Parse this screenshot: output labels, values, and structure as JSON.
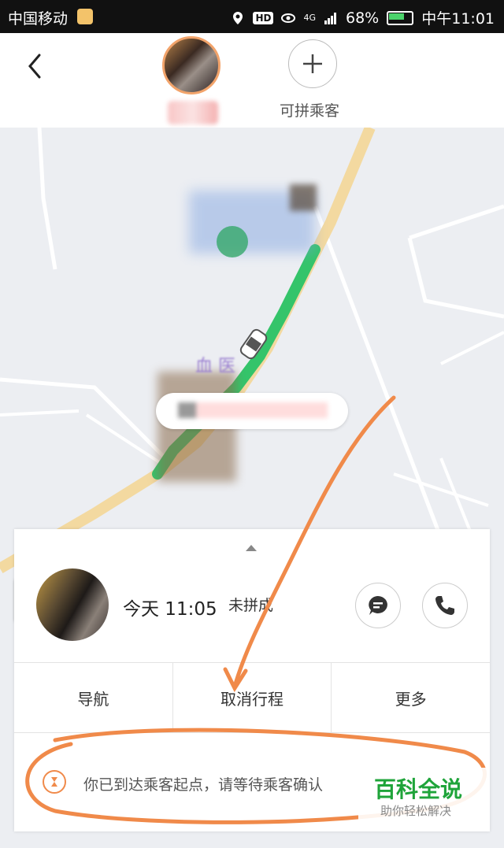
{
  "status_bar": {
    "carrier": "中国移动",
    "network": "4G",
    "battery": "68%",
    "time": "中午11:01",
    "hd_badge": "HD"
  },
  "header": {
    "add_label": "可拼乘客"
  },
  "trip": {
    "time": "今天 11:05",
    "status": "未拼成"
  },
  "actions": [
    "导航",
    "取消行程",
    "更多"
  ],
  "notice": "你已到达乘客起点，请等待乘客确认",
  "map": {
    "poi_label": "血    医"
  },
  "watermark": {
    "title": "百科全说",
    "subtitle": "助你轻松解决"
  },
  "colors": {
    "route_green": "#34c46a",
    "annotation_orange": "#f08a4a",
    "road_yellow": "#f3d9a0",
    "watermark_green": "#1fa43a"
  }
}
